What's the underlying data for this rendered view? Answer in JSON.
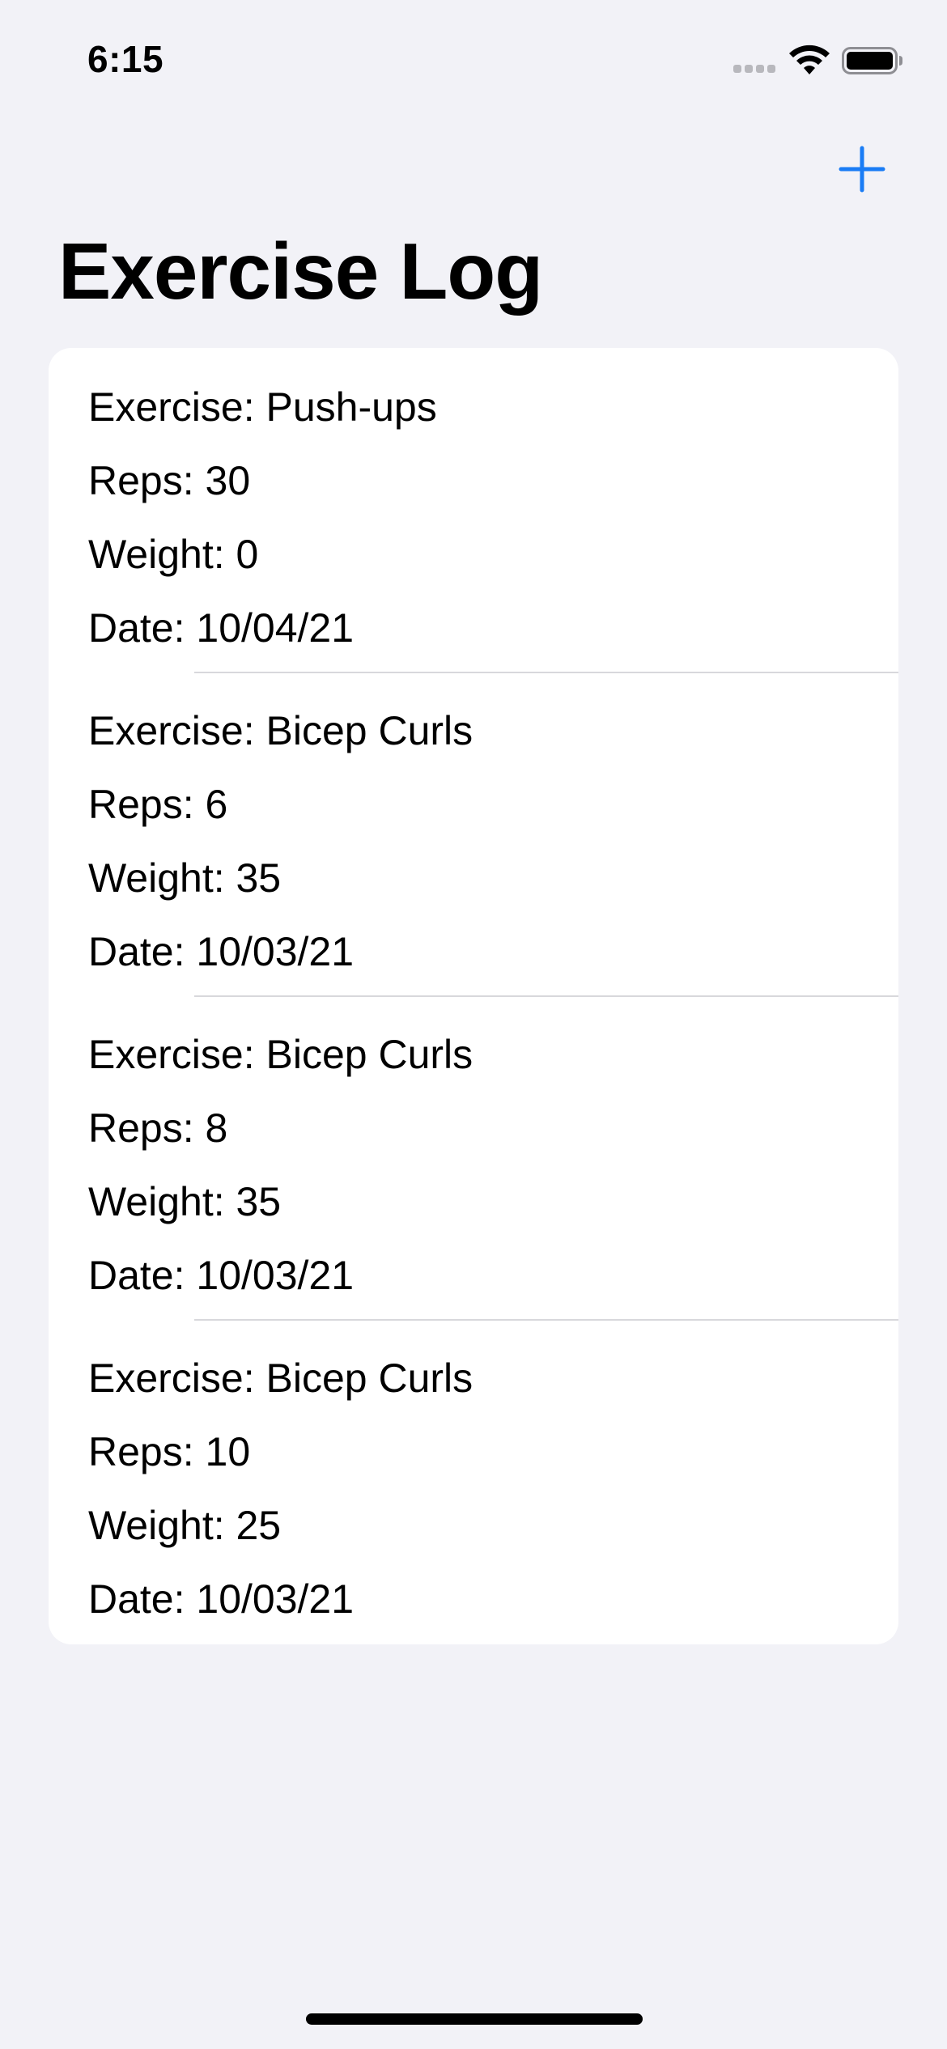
{
  "status_bar": {
    "time": "6:15"
  },
  "nav": {
    "title": "Exercise Log",
    "add_icon": "plus-icon",
    "accent_color": "#1a7cf5"
  },
  "logs": [
    {
      "exercise": "Exercise: Push-ups",
      "reps": "Reps: 30",
      "weight": "Weight: 0",
      "date": "Date: 10/04/21"
    },
    {
      "exercise": "Exercise: Bicep Curls",
      "reps": "Reps: 6",
      "weight": "Weight: 35",
      "date": "Date: 10/03/21"
    },
    {
      "exercise": "Exercise: Bicep Curls",
      "reps": "Reps: 8",
      "weight": "Weight: 35",
      "date": "Date: 10/03/21"
    },
    {
      "exercise": "Exercise: Bicep Curls",
      "reps": "Reps: 10",
      "weight": "Weight: 25",
      "date": "Date: 10/03/21"
    }
  ]
}
